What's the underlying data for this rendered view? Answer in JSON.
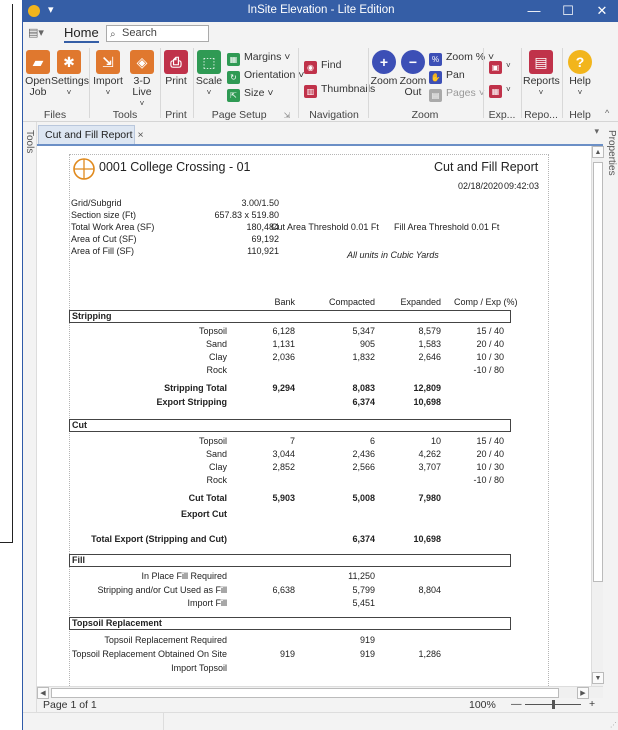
{
  "window": {
    "title": "InSite Elevation - Lite Edition",
    "minimize": "—",
    "maximize": "☐",
    "close": "✕",
    "quick_access": "▾"
  },
  "menu": {
    "home_tab": "Home",
    "search_placeholder": "Search"
  },
  "ribbon": {
    "open_job": "Open Job",
    "settings": "Settings",
    "import": "Import",
    "live_3d": "3-D Live",
    "print": "Print",
    "scale": "Scale",
    "margins": "Margins ˅",
    "orientation": "Orientation ˅",
    "size": "Size ˅",
    "find": "Find",
    "thumbnails": "Thumbnails",
    "zoom": "Zoom",
    "zoom_out": "Zoom Out",
    "zoom_pct": "Zoom % ˅",
    "pan": "Pan",
    "pages": "Pages ˅",
    "reports": "Reports",
    "help": "Help",
    "groups": {
      "files": "Files",
      "tools": "Tools",
      "print": "Print",
      "page_setup": "Page Setup",
      "navigation": "Navigation",
      "zoom": "Zoom",
      "export": "Exp...",
      "reports": "Repo...",
      "help": "Help"
    }
  },
  "side": {
    "tools": "Tools",
    "properties": "Properties"
  },
  "doc_tab": {
    "label": "Cut and Fill Report",
    "close": "×"
  },
  "report": {
    "project": "0001 College Crossing - 01",
    "report_title": "Cut and Fill Report",
    "date": "02/18/2020",
    "time": "09:42:03",
    "info": [
      {
        "label": "Grid/Subgrid",
        "value": "3.00/1.50"
      },
      {
        "label": "Section size (Ft)",
        "value": "657.83 x 519.80"
      },
      {
        "label": "Total Work Area (SF)",
        "value": "180,484"
      },
      {
        "label": "Area of Cut (SF)",
        "value": "69,192"
      },
      {
        "label": "Area of Fill (SF)",
        "value": "110,921"
      }
    ],
    "cut_threshold": "Cut Area Threshold 0.01 Ft",
    "fill_threshold": "Fill Area Threshold 0.01 Ft",
    "units_note": "All units in Cubic Yards",
    "columns": [
      "Bank",
      "Compacted",
      "Expanded",
      "Comp / Exp (%)"
    ],
    "stripping": {
      "header": "Stripping",
      "rows": [
        {
          "label": "Topsoil",
          "bank": "6,128",
          "compacted": "5,347",
          "expanded": "8,579",
          "pct": "15 / 40"
        },
        {
          "label": "Sand",
          "bank": "1,131",
          "compacted": "905",
          "expanded": "1,583",
          "pct": "20 / 40"
        },
        {
          "label": "Clay",
          "bank": "2,036",
          "compacted": "1,832",
          "expanded": "2,646",
          "pct": "10 / 30"
        },
        {
          "label": "Rock",
          "bank": "",
          "compacted": "",
          "expanded": "",
          "pct": "-10 / 80"
        }
      ],
      "total_label": "Stripping Total",
      "total_bank": "9,294",
      "total_compacted": "8,083",
      "total_expanded": "12,809",
      "export_label": "Export Stripping",
      "export_compacted": "6,374",
      "export_expanded": "10,698"
    },
    "cut": {
      "header": "Cut",
      "rows": [
        {
          "label": "Topsoil",
          "bank": "7",
          "compacted": "6",
          "expanded": "10",
          "pct": "15 / 40"
        },
        {
          "label": "Sand",
          "bank": "3,044",
          "compacted": "2,436",
          "expanded": "4,262",
          "pct": "20 / 40"
        },
        {
          "label": "Clay",
          "bank": "2,852",
          "compacted": "2,566",
          "expanded": "3,707",
          "pct": "10 / 30"
        },
        {
          "label": "Rock",
          "bank": "",
          "compacted": "",
          "expanded": "",
          "pct": "-10 / 80"
        }
      ],
      "total_label": "Cut Total",
      "total_bank": "5,903",
      "total_compacted": "5,008",
      "total_expanded": "7,980",
      "export_label": "Export Cut"
    },
    "total_export": {
      "label": "Total Export (Stripping and Cut)",
      "compacted": "6,374",
      "expanded": "10,698"
    },
    "fill": {
      "header": "Fill",
      "rows": [
        {
          "label": "In Place Fill Required",
          "bank": "",
          "compacted": "11,250",
          "expanded": ""
        },
        {
          "label": "Stripping and/or Cut Used as Fill",
          "bank": "6,638",
          "compacted": "5,799",
          "expanded": "8,804"
        },
        {
          "label": "Import Fill",
          "bank": "",
          "compacted": "5,451",
          "expanded": ""
        }
      ]
    },
    "topsoil": {
      "header": "Topsoil Replacement",
      "rows": [
        {
          "label": "Topsoil Replacement Required",
          "bank": "",
          "compacted": "919",
          "expanded": ""
        },
        {
          "label": "Topsoil Replacement Obtained On Site",
          "bank": "919",
          "compacted": "919",
          "expanded": "1,286"
        },
        {
          "label": "Import Topsoil",
          "bank": "",
          "compacted": "",
          "expanded": ""
        }
      ]
    }
  },
  "status": {
    "page": "Page 1 of 1",
    "zoom": "100%",
    "minus": "—",
    "plus": "+",
    "zoom_level": 0.5
  }
}
